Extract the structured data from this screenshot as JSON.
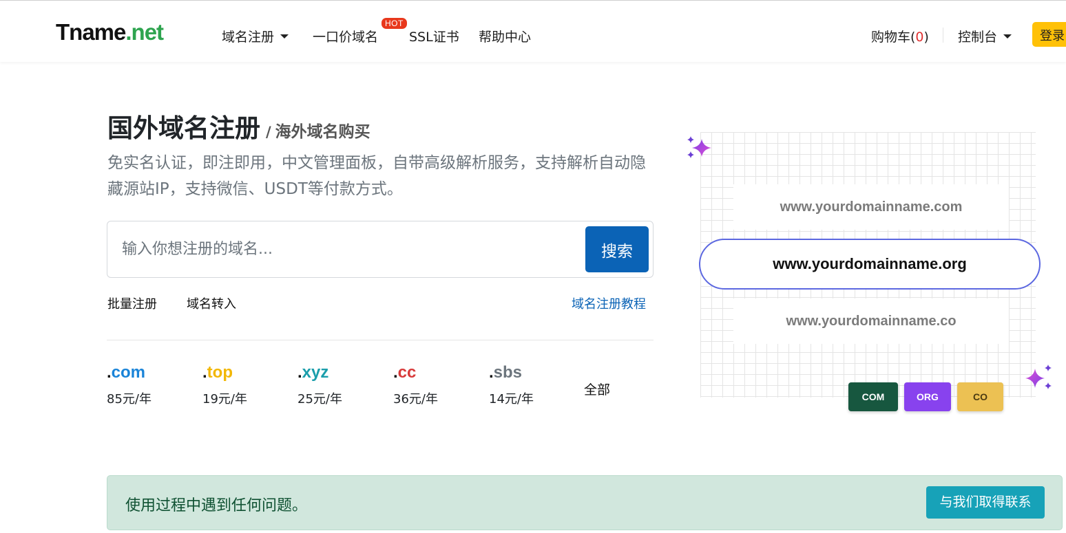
{
  "brand": {
    "name": "Tname",
    "tld": ".net",
    "accent": "#2ea44f"
  },
  "nav": {
    "items": [
      {
        "label": "域名注册",
        "has_dropdown": true
      },
      {
        "label": "一口价域名",
        "badge": "HOT"
      },
      {
        "label": "SSL证书"
      },
      {
        "label": "帮助中心"
      }
    ],
    "cart": {
      "label": "购物车(",
      "count": "0",
      "suffix": ")"
    },
    "console": {
      "label": "控制台",
      "has_dropdown": true
    },
    "login": "登录"
  },
  "hero": {
    "title": "国外域名注册",
    "separator": "/",
    "subtitle": "海外域名购买",
    "description": "免实名认证，即注即用，中文管理面板，自带高级解析服务，支持解析自动隐藏源站IP，支持微信、USDT等付款方式。"
  },
  "search": {
    "placeholder": "输入你想注册的域名...",
    "value": "",
    "button": "搜索",
    "button_color": "#0b63b6"
  },
  "links": {
    "bulk": "批量注册",
    "transfer": "域名转入",
    "tutorial": "域名注册教程"
  },
  "tlds": [
    {
      "dot": ".",
      "ext": "com",
      "price": "85元/年",
      "color": "#1a84d8"
    },
    {
      "dot": ".",
      "ext": "top",
      "price": "19元/年",
      "color": "#f2b705"
    },
    {
      "dot": ".",
      "ext": "xyz",
      "price": "25元/年",
      "color": "#1b9eab"
    },
    {
      "dot": ".",
      "ext": "cc",
      "price": "36元/年",
      "color": "#d83a3a"
    },
    {
      "dot": ".",
      "ext": "sbs",
      "price": "14元/年",
      "color": "#6c757d"
    }
  ],
  "tld_all": "全部",
  "illustration": {
    "domains": [
      "www.yourdomainname.com",
      "www.yourdomainname.org",
      "www.yourdomainname.co"
    ],
    "tags": [
      "COM",
      "ORG",
      "CO"
    ],
    "highlight_color": "#5b67e0",
    "icons": [
      "sparkle-icon"
    ]
  },
  "help": {
    "text": "使用过程中遇到任何问题。",
    "button": "与我们取得联系",
    "bg_color": "#d1e7dd",
    "button_color": "#17a2b8"
  }
}
